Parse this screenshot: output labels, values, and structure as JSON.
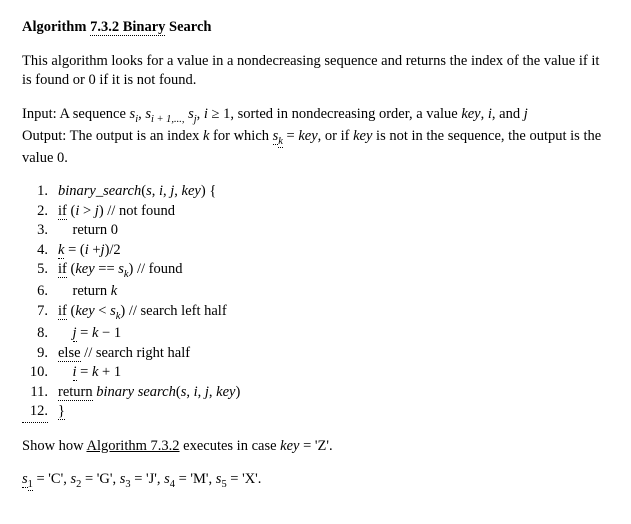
{
  "title_prefix": "Algorithm ",
  "title_num": "7.3.2  Binary",
  "title_suffix": " Search",
  "desc": "This algorithm looks for a value in a nondecreasing sequence and returns the index of the value if it is found or 0 if it is not found.",
  "input_label": "Input:   ",
  "input_a": "A sequence ",
  "input_b": ", sorted in nondecreasing order, a value ",
  "input_c": ", and ",
  "output_label": "Output:   ",
  "output_a": "The output is an index ",
  "output_b": " for which ",
  "output_c": ", or if ",
  "output_d": " is not in the sequence, the output is the value 0.",
  "code": {
    "l1a": "binary_search",
    "l1b": "(",
    "l1c": ") {",
    "l2a": "if",
    "l2b": " (",
    "l2c": ") // not found",
    "l3": "    return 0",
    "l4a": " = (",
    "l4b": ")/2",
    "l5a": "if",
    "l5b": " (",
    "l5c": " == ",
    "l5d": ") // found",
    "l6": "    return ",
    "l7a": "if",
    "l7b": " (",
    "l7c": " < ",
    "l7d": ") // search left half",
    "l8a": " = ",
    "l8b": " − 1",
    "l9a": "else",
    "l9b": " // search right half",
    "l10a": " = ",
    "l10b": " + 1",
    "l11a": "return",
    "l11b": " binary search",
    "l11c": "(",
    "l11d": ")",
    "l12": "}"
  },
  "vars": {
    "s": "s",
    "i": "i",
    "j": "j",
    "k": "k",
    "key": "key",
    "si": "s",
    "si_sub": "i",
    "sip1": "s",
    "sip1_sub": "i + 1,...,",
    "sj": "s",
    "sj_sub": "j",
    "sk": "s",
    "sk_sub": "k",
    "ge1": " ≥ 1",
    "gt": " > ",
    "eq": " = ",
    "comma": ", "
  },
  "show_a": "Show how ",
  "show_link": "Algorithm 7.3.2",
  "show_b": " executes in case ",
  "show_c": " = 'Z'.",
  "assign": {
    "s1l": "s",
    "s1s": "1",
    "s1v": " = 'C',  ",
    "s2l": "s",
    "s2s": "2",
    "s2v": " = 'G',  ",
    "s3l": "s",
    "s3s": "3",
    "s3v": " = 'J',  ",
    "s4l": "s",
    "s4s": "4",
    "s4v": " = 'M',  ",
    "s5l": "s",
    "s5s": "5",
    "s5v": " = 'X'."
  }
}
